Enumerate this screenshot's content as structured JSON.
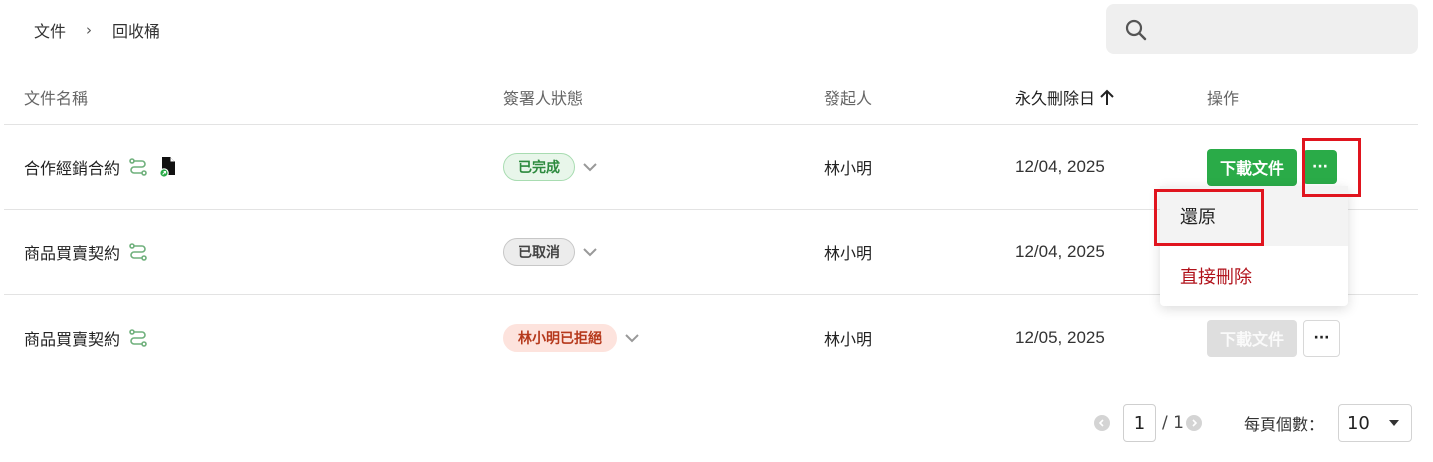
{
  "breadcrumb": {
    "root": "文件",
    "separator": "›",
    "current": "回收桶"
  },
  "search": {
    "placeholder": ""
  },
  "table": {
    "headers": {
      "name": "文件名稱",
      "status": "簽署人狀態",
      "sender": "發起人",
      "delete_date": "永久刪除日",
      "actions": "操作"
    },
    "sort_indicator": "↑",
    "rows": [
      {
        "name": "合作經銷合約",
        "status": "已完成",
        "status_type": "done",
        "sender": "林小明",
        "date": "12/04, 2025",
        "download": "下載文件",
        "download_enabled": true,
        "has_doc_icon": true
      },
      {
        "name": "商品買賣契約",
        "status": "已取消",
        "status_type": "cancel",
        "sender": "林小明",
        "date": "12/04, 2025",
        "download": "",
        "download_enabled": false,
        "has_doc_icon": false
      },
      {
        "name": "商品買賣契約",
        "status": "林小明已拒絕",
        "status_type": "reject",
        "sender": "林小明",
        "date": "12/05, 2025",
        "download": "下載文件",
        "download_enabled": false,
        "has_doc_icon": false
      }
    ],
    "more_label": "···"
  },
  "menu": {
    "restore": "還原",
    "delete": "直接刪除"
  },
  "pagination": {
    "current_page": "1",
    "total": "/ 1",
    "per_page_label": "每頁個數：",
    "per_page_value": "10"
  },
  "colors": {
    "primary": "#2aab48",
    "danger": "#b1121b",
    "highlight": "#e0141e"
  }
}
